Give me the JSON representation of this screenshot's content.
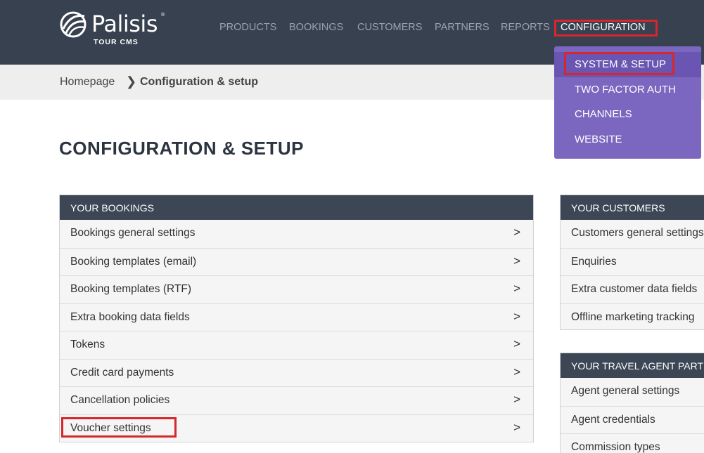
{
  "brand": {
    "name": "Palisis",
    "sub": "TOUR CMS",
    "reg": "®"
  },
  "nav": {
    "items": [
      {
        "label": "PRODUCTS"
      },
      {
        "label": "BOOKINGS"
      },
      {
        "label": "CUSTOMERS"
      },
      {
        "label": "PARTNERS"
      },
      {
        "label": "REPORTS"
      },
      {
        "label": "CONFIGURATION"
      }
    ]
  },
  "dropdown": {
    "items": [
      {
        "label": "SYSTEM & SETUP"
      },
      {
        "label": "TWO FACTOR AUTH"
      },
      {
        "label": "CHANNELS"
      },
      {
        "label": "WEBSITE"
      }
    ]
  },
  "breadcrumb": {
    "home": "Homepage",
    "current": "Configuration & setup"
  },
  "page": {
    "title": "CONFIGURATION & SETUP"
  },
  "panels": {
    "bookings": {
      "title": "YOUR BOOKINGS",
      "rows": [
        "Bookings general settings",
        "Booking templates (email)",
        "Booking templates (RTF)",
        "Extra booking data fields",
        "Tokens",
        "Credit card payments",
        "Cancellation policies",
        "Voucher settings"
      ]
    },
    "customers": {
      "title": "YOUR CUSTOMERS",
      "rows": [
        "Customers general settings",
        "Enquiries",
        "Extra customer data fields",
        "Offline marketing tracking"
      ]
    },
    "agents": {
      "title": "YOUR TRAVEL AGENT PARTNERS",
      "rows": [
        "Agent general settings",
        "Agent credentials",
        "Commission types"
      ]
    }
  },
  "colors": {
    "topbar": "#374150",
    "accent_purple": "#7b67c0",
    "highlight_red": "#d7262c",
    "panel_header": "#3d4654"
  }
}
